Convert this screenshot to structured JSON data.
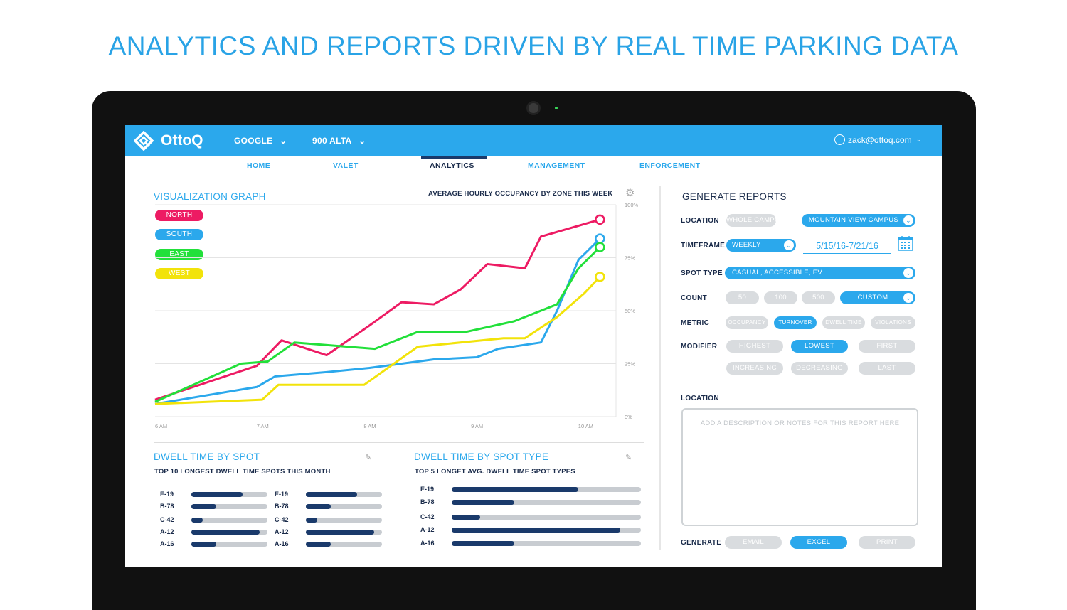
{
  "headline": "ANALYTICS AND REPORTS DRIVEN BY REAL TIME PARKING DATA",
  "app": {
    "logo_text": "OttoQ",
    "org_dropdown": "GOOGLE",
    "site_dropdown": "900 ALTA",
    "user_email": "zack@ottoq.com"
  },
  "nav": {
    "items": [
      "HOME",
      "VALET",
      "ANALYTICS",
      "MANAGEMENT",
      "ENFORCEMENT"
    ],
    "active": "ANALYTICS"
  },
  "graph": {
    "section_title": "VISUALIZATION GRAPH",
    "chart_title": "AVERAGE HOURLY OCCUPANCY BY ZONE THIS WEEK",
    "legend": [
      "NORTH",
      "SOUTH",
      "EAST",
      "WEST"
    ]
  },
  "chart_data": {
    "type": "line",
    "title": "AVERAGE HOURLY OCCUPANCY BY ZONE THIS WEEK",
    "x_ticks": [
      "6 AM",
      "7 AM",
      "8 AM",
      "9 AM",
      "10 AM"
    ],
    "y_ticks": [
      "100%",
      "75%",
      "50%",
      "25%",
      "0%"
    ],
    "xlim": [
      0,
      4.3
    ],
    "ylim": [
      0,
      100
    ],
    "grid": true,
    "legend_position": "top-left",
    "series": [
      {
        "name": "NORTH",
        "color": "#ed1b63",
        "x": [
          0,
          0.95,
          1.18,
          1.6,
          2.0,
          2.3,
          2.6,
          2.85,
          3.1,
          3.45,
          3.6,
          4.15
        ],
        "y": [
          8,
          24,
          36,
          29,
          43,
          54,
          53,
          60,
          72,
          70,
          85,
          93
        ]
      },
      {
        "name": "SOUTH",
        "color": "#2ba8ec",
        "x": [
          0,
          0.95,
          1.12,
          1.6,
          2.0,
          2.6,
          3.0,
          3.2,
          3.6,
          3.75,
          3.95,
          4.15
        ],
        "y": [
          6,
          14,
          19,
          21,
          23,
          27,
          28,
          32,
          35,
          50,
          74,
          84
        ]
      },
      {
        "name": "EAST",
        "color": "#22e03a",
        "x": [
          0,
          0.8,
          1.05,
          1.3,
          2.05,
          2.45,
          2.9,
          3.35,
          3.75,
          3.95,
          4.15
        ],
        "y": [
          7,
          25,
          26,
          35,
          32,
          40,
          40,
          45,
          53,
          70,
          80
        ]
      },
      {
        "name": "WEST",
        "color": "#f2e30a",
        "x": [
          0,
          1.0,
          1.15,
          1.95,
          2.45,
          3.25,
          3.45,
          3.75,
          4.0,
          4.15
        ],
        "y": [
          6,
          8,
          15,
          15,
          33,
          37,
          37,
          47,
          58,
          66
        ]
      }
    ]
  },
  "dwell_spot": {
    "title": "DWELL TIME BY SPOT",
    "subtitle": "TOP 10 LONGEST DWELL TIME SPOTS THIS MONTH",
    "columns": [
      [
        {
          "label": "E-19",
          "value": 0.67
        },
        {
          "label": "B-78",
          "value": 0.33
        },
        {
          "label": "C-42",
          "value": 0.15
        },
        {
          "label": "A-12",
          "value": 0.9
        },
        {
          "label": "A-16",
          "value": 0.33
        }
      ],
      [
        {
          "label": "E-19",
          "value": 0.67
        },
        {
          "label": "B-78",
          "value": 0.33
        },
        {
          "label": "C-42",
          "value": 0.15
        },
        {
          "label": "A-12",
          "value": 0.9
        },
        {
          "label": "A-16",
          "value": 0.33
        }
      ]
    ]
  },
  "dwell_type": {
    "title": "DWELL TIME BY SPOT TYPE",
    "subtitle": "TOP 5 LONGET AVG. DWELL TIME SPOT TYPES",
    "rows": [
      {
        "label": "E-19",
        "value": 0.67
      },
      {
        "label": "B-78",
        "value": 0.33
      },
      {
        "label": "C-42",
        "value": 0.15
      },
      {
        "label": "A-12",
        "value": 0.89
      },
      {
        "label": "A-16",
        "value": 0.33
      }
    ]
  },
  "reports": {
    "title": "GENERATE REPORTS",
    "location_label": "LOCATION",
    "location_options": [
      "WHOLE CAMPUS",
      "MOUNTAIN VIEW CAMPUS"
    ],
    "location_selected": "MOUNTAIN VIEW CAMPUS",
    "timeframe_label": "TIMEFRAME",
    "timeframe_value": "WEEKLY",
    "date_range": "5/15/16-7/21/16",
    "spot_type_label": "SPOT TYPE",
    "spot_type_value": "CASUAL, ACCESSIBLE, EV",
    "count_label": "COUNT",
    "count_options": [
      "50",
      "100",
      "500"
    ],
    "count_custom": "CUSTOM",
    "metric_label": "METRIC",
    "metric_options": [
      "OCCUPANCY",
      "TURNOVER",
      "DWELL TIME",
      "VIOLATIONS"
    ],
    "metric_selected": "TURNOVER",
    "modifier_label": "MODIFIER",
    "modifier_options": [
      "HIGHEST",
      "LOWEST",
      "FIRST",
      "INCREASING",
      "DECREASING",
      "LAST"
    ],
    "modifier_selected": "LOWEST",
    "notes_label": "LOCATION",
    "notes_placeholder": "ADD A DESCRIPTION OR NOTES FOR THIS REPORT HERE",
    "generate_label": "GENERATE",
    "generate_options": [
      "EMAIL",
      "EXCEL",
      "PRINT"
    ],
    "generate_selected": "EXCEL"
  }
}
